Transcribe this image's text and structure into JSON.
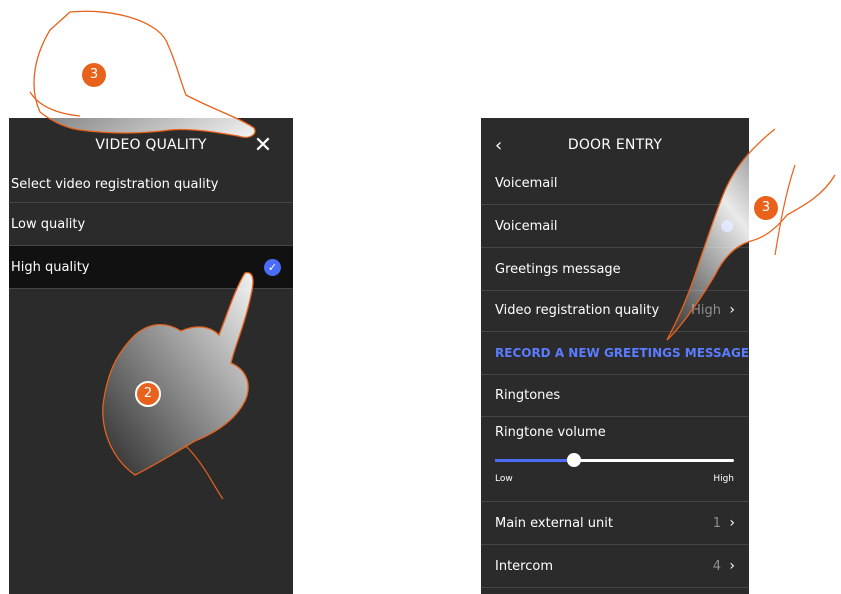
{
  "left_screen": {
    "title": "VIDEO QUALITY",
    "subtitle": "Select video registration quality",
    "options": [
      {
        "label": "Low quality",
        "selected": false
      },
      {
        "label": "High quality",
        "selected": true
      }
    ],
    "check_icon": "check-icon"
  },
  "right_screen": {
    "title": "DOOR ENTRY",
    "section_header": "Voicemail",
    "rows": {
      "voicemail": "Voicemail",
      "greetings": "Greetings message",
      "video_quality": "Video registration quality",
      "video_quality_value": "High",
      "record": "RECORD A NEW GREETINGS MESSAGE",
      "ringtones": "Ringtones",
      "main_unit": "Main external unit",
      "main_unit_value": "1",
      "intercom": "Intercom",
      "intercom_value": "4"
    },
    "ringtone_volume": {
      "label": "Ringtone volume",
      "min_label": "Low",
      "max_label": "High",
      "level": 0.33
    }
  },
  "badges": {
    "left_top": "3",
    "left_bottom": "2",
    "right": "3"
  },
  "colors": {
    "accent": "#4a6cf7",
    "badge": "#e8621b",
    "screen_bg": "#2b2b2b"
  }
}
